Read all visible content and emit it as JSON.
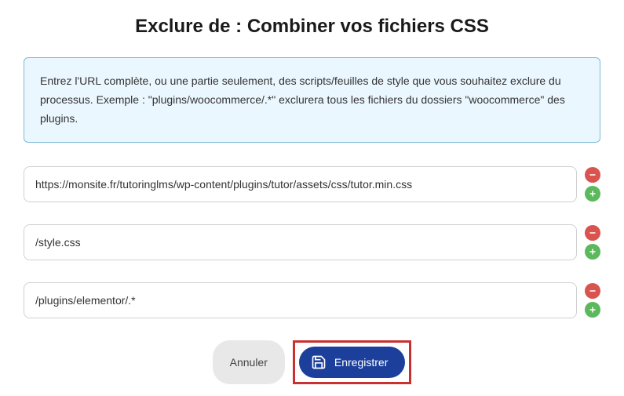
{
  "title": "Exclure de : Combiner vos fichiers CSS",
  "info_text": "Entrez l'URL complète, ou une partie seulement, des scripts/feuilles de style que vous souhaitez exclure du processus. Exemple : \"plugins/woocommerce/.*\" exclurera tous les fichiers du dossiers \"woocommerce\" des plugins.",
  "inputs": [
    "https://monsite.fr/tutoringlms/wp-content/plugins/tutor/assets/css/tutor.min.css",
    "/style.css",
    "/plugins/elementor/.*"
  ],
  "buttons": {
    "cancel": "Annuler",
    "save": "Enregistrer"
  },
  "icons": {
    "remove": "minus-icon",
    "add": "plus-icon",
    "save": "save-icon"
  }
}
